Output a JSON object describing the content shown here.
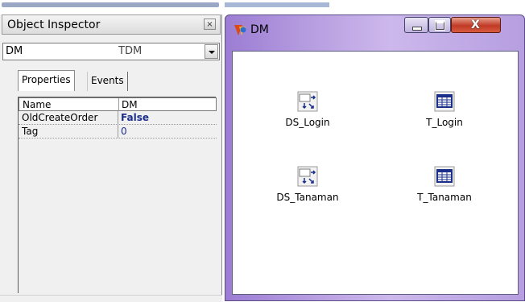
{
  "object_inspector": {
    "title": "Object Inspector",
    "close_icon": "close-icon",
    "selector": {
      "name": "DM",
      "type": "TDM"
    },
    "tabs": [
      {
        "label": "Properties",
        "active": true
      },
      {
        "label": "Events",
        "active": false
      }
    ],
    "properties": [
      {
        "name": "Name",
        "value": "DM"
      },
      {
        "name": "OldCreateOrder",
        "value": "False"
      },
      {
        "name": "Tag",
        "value": "0"
      }
    ]
  },
  "dm_window": {
    "title": "DM",
    "app_icon": "delphi-icon",
    "components": [
      {
        "label": "DS_Login",
        "icon": "datasource-icon"
      },
      {
        "label": "T_Login",
        "icon": "table-icon"
      },
      {
        "label": "DS_Tanaman",
        "icon": "datasource-icon"
      },
      {
        "label": "T_Tanaman",
        "icon": "table-icon"
      }
    ]
  },
  "colors": {
    "title_bar": "#b89fe1",
    "close_button": "#c13a26",
    "property_value": "#1d2f8c"
  }
}
